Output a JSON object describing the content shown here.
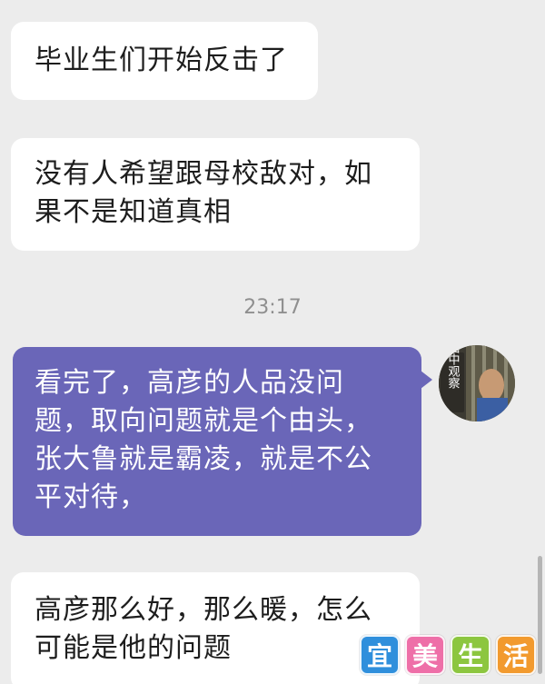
{
  "messages": [
    {
      "id": "msg1",
      "direction": "incoming",
      "text": "毕业生们开始反击了"
    },
    {
      "id": "msg2",
      "direction": "incoming",
      "text": "没有人希望跟母校敌对，如果不是知道真相"
    },
    {
      "id": "msg3",
      "direction": "outgoing",
      "text": "看完了，高彦的人品没问题，取向问题就是个由头，张大鲁就是霸凌，就是不公平对待，",
      "avatar_text": "暗中观察"
    },
    {
      "id": "msg4",
      "direction": "incoming",
      "text": "高彦那么好，那么暖，怎么可能是他的问题"
    }
  ],
  "timestamp": "23:17",
  "watermark": {
    "chars": [
      "宜",
      "美",
      "生",
      "活"
    ],
    "colors": [
      "#2f8fdc",
      "#ee6fa8",
      "#8cc63f",
      "#f29a2e"
    ]
  },
  "colors": {
    "background": "#ececec",
    "incoming_bubble": "#ffffff",
    "outgoing_bubble": "#6a66b8",
    "timestamp": "#8f8f8f"
  },
  "icons": {
    "avatar": "avatar-image",
    "scrollbar": "scrollbar-thumb"
  }
}
